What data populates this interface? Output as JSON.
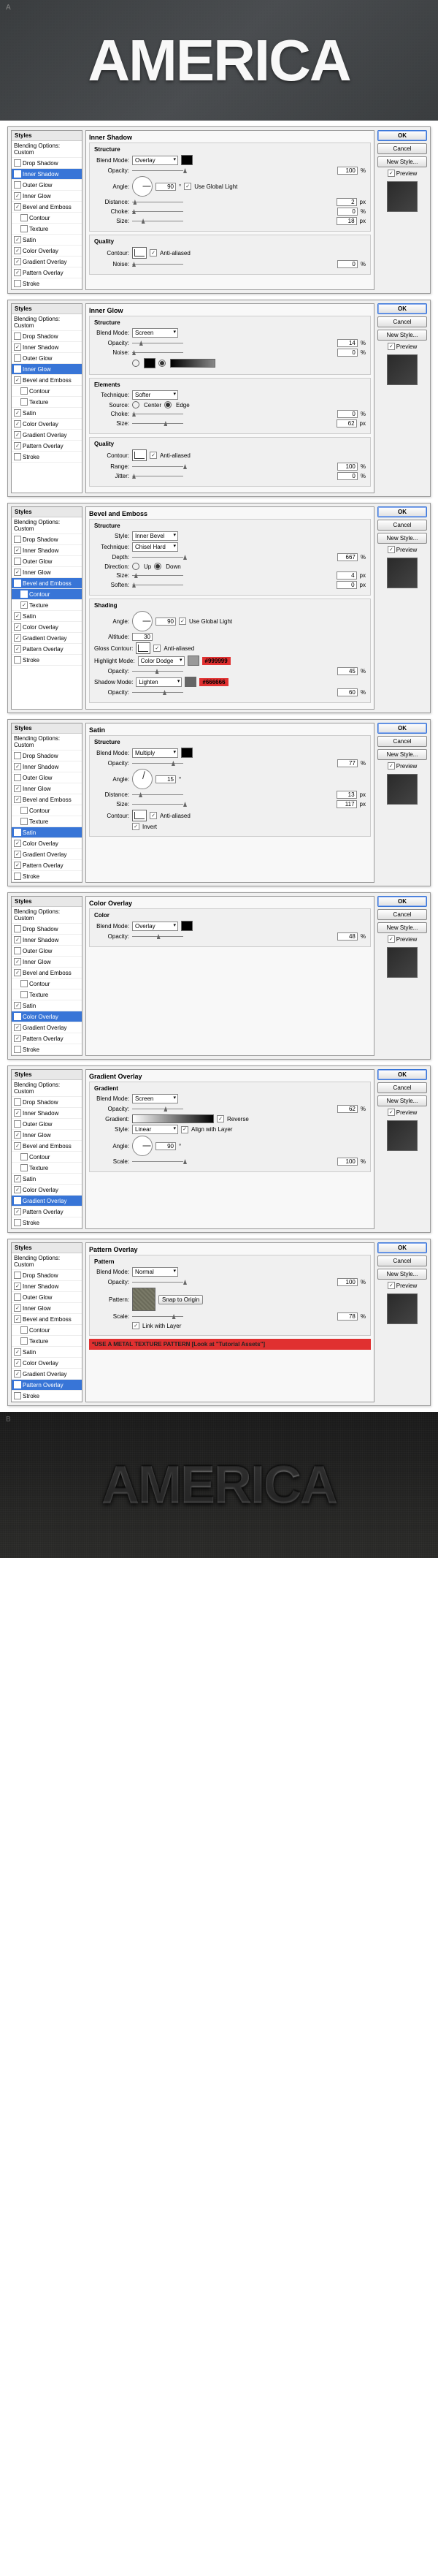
{
  "hero": {
    "label": "A",
    "text": "AMERICA"
  },
  "footer": {
    "label": "B",
    "text": "AMERICA"
  },
  "common": {
    "styles_header": "Styles",
    "blending_options": "Blending Options: Custom",
    "ok": "OK",
    "cancel": "Cancel",
    "new_style": "New Style...",
    "preview": "Preview"
  },
  "style_names": {
    "drop_shadow": "Drop Shadow",
    "inner_shadow": "Inner Shadow",
    "outer_glow": "Outer Glow",
    "inner_glow": "Inner Glow",
    "bevel_emboss": "Bevel and Emboss",
    "contour": "Contour",
    "texture": "Texture",
    "satin": "Satin",
    "color_overlay": "Color Overlay",
    "gradient_overlay": "Gradient Overlay",
    "pattern_overlay": "Pattern Overlay",
    "stroke": "Stroke"
  },
  "panels": [
    {
      "id": "inner_shadow",
      "title": "Inner Shadow",
      "sections": [
        {
          "name": "Structure",
          "fields": [
            {
              "label": "Blend Mode:",
              "type": "dd",
              "value": "Overlay",
              "swatch": "#000"
            },
            {
              "label": "Opacity:",
              "type": "slider",
              "value": 100,
              "unit": "%"
            },
            {
              "label": "Angle:",
              "type": "dial",
              "value": 90,
              "check": "Use Global Light",
              "check_on": true
            },
            {
              "label": "Distance:",
              "type": "slider",
              "value": 2,
              "unit": "px"
            },
            {
              "label": "Choke:",
              "type": "slider",
              "value": 0,
              "unit": "%"
            },
            {
              "label": "Size:",
              "type": "slider",
              "value": 18,
              "unit": "px"
            }
          ]
        },
        {
          "name": "Quality",
          "fields": [
            {
              "label": "Contour:",
              "type": "contour",
              "check": "Anti-aliased",
              "check_on": true
            },
            {
              "label": "Noise:",
              "type": "slider",
              "value": 0,
              "unit": "%"
            }
          ]
        }
      ],
      "checks": {
        "drop_shadow": false,
        "inner_shadow": true,
        "outer_glow": false,
        "inner_glow": true,
        "bevel_emboss": true,
        "contour": false,
        "texture": false,
        "satin": true,
        "color_overlay": true,
        "gradient_overlay": true,
        "pattern_overlay": true,
        "stroke": false
      }
    },
    {
      "id": "inner_glow",
      "title": "Inner Glow",
      "sections": [
        {
          "name": "Structure",
          "fields": [
            {
              "label": "Blend Mode:",
              "type": "dd",
              "value": "Screen"
            },
            {
              "label": "Opacity:",
              "type": "slider",
              "value": 14,
              "unit": "%"
            },
            {
              "label": "Noise:",
              "type": "slider",
              "value": 0,
              "unit": "%"
            },
            {
              "label": "",
              "type": "grad_choice"
            }
          ]
        },
        {
          "name": "Elements",
          "fields": [
            {
              "label": "Technique:",
              "type": "dd",
              "value": "Softer"
            },
            {
              "label": "Source:",
              "type": "radio",
              "options": [
                "Center",
                "Edge"
              ],
              "value": "Edge"
            },
            {
              "label": "Choke:",
              "type": "slider",
              "value": 0,
              "unit": "%"
            },
            {
              "label": "Size:",
              "type": "slider",
              "value": 62,
              "unit": "px"
            }
          ]
        },
        {
          "name": "Quality",
          "fields": [
            {
              "label": "Contour:",
              "type": "contour",
              "check": "Anti-aliased",
              "check_on": true
            },
            {
              "label": "Range:",
              "type": "slider",
              "value": 100,
              "unit": "%"
            },
            {
              "label": "Jitter:",
              "type": "slider",
              "value": 0,
              "unit": "%"
            }
          ]
        }
      ],
      "checks": {
        "drop_shadow": false,
        "inner_shadow": true,
        "outer_glow": false,
        "inner_glow": true,
        "bevel_emboss": true,
        "contour": false,
        "texture": false,
        "satin": true,
        "color_overlay": true,
        "gradient_overlay": true,
        "pattern_overlay": true,
        "stroke": false
      }
    },
    {
      "id": "bevel_emboss",
      "title": "Bevel and Emboss",
      "sections": [
        {
          "name": "Structure",
          "fields": [
            {
              "label": "Style:",
              "type": "dd",
              "value": "Inner Bevel"
            },
            {
              "label": "Technique:",
              "type": "dd",
              "value": "Chisel Hard"
            },
            {
              "label": "Depth:",
              "type": "slider",
              "value": 667,
              "unit": "%"
            },
            {
              "label": "Direction:",
              "type": "radio",
              "options": [
                "Up",
                "Down"
              ],
              "value": "Down"
            },
            {
              "label": "Size:",
              "type": "slider",
              "value": 4,
              "unit": "px"
            },
            {
              "label": "Soften:",
              "type": "slider",
              "value": 0,
              "unit": "px"
            }
          ]
        },
        {
          "name": "Shading",
          "fields": [
            {
              "label": "Angle:",
              "type": "dial2",
              "value": 90,
              "alt_label": "Altitude:",
              "alt_value": 30,
              "check": "Use Global Light",
              "check_on": true
            },
            {
              "label": "Gloss Contour:",
              "type": "contour",
              "check": "Anti-aliased",
              "check_on": true
            },
            {
              "label": "Highlight Mode:",
              "type": "dd",
              "value": "Color Dodge",
              "swatch": "#999",
              "hex": "#999999"
            },
            {
              "label": "Opacity:",
              "type": "slider",
              "value": 45,
              "unit": "%"
            },
            {
              "label": "Shadow Mode:",
              "type": "dd",
              "value": "Lighten",
              "swatch": "#666",
              "hex": "#666666"
            },
            {
              "label": "Opacity:",
              "type": "slider",
              "value": 60,
              "unit": "%"
            }
          ]
        }
      ],
      "checks": {
        "drop_shadow": false,
        "inner_shadow": true,
        "outer_glow": false,
        "inner_glow": true,
        "bevel_emboss": true,
        "contour": true,
        "texture": true,
        "satin": true,
        "color_overlay": true,
        "gradient_overlay": true,
        "pattern_overlay": true,
        "stroke": false
      },
      "sub_sel": "contour"
    },
    {
      "id": "satin",
      "title": "Satin",
      "sections": [
        {
          "name": "Structure",
          "fields": [
            {
              "label": "Blend Mode:",
              "type": "dd",
              "value": "Multiply",
              "swatch": "#000"
            },
            {
              "label": "Opacity:",
              "type": "slider",
              "value": 77,
              "unit": "%"
            },
            {
              "label": "Angle:",
              "type": "dial",
              "value": 15
            },
            {
              "label": "Distance:",
              "type": "slider",
              "value": 13,
              "unit": "px"
            },
            {
              "label": "Size:",
              "type": "slider",
              "value": 117,
              "unit": "px"
            },
            {
              "label": "Contour:",
              "type": "contour",
              "check": "Anti-aliased",
              "check_on": true,
              "check2": "Invert",
              "check2_on": true
            }
          ]
        }
      ],
      "checks": {
        "drop_shadow": false,
        "inner_shadow": true,
        "outer_glow": false,
        "inner_glow": true,
        "bevel_emboss": true,
        "contour": false,
        "texture": false,
        "satin": true,
        "color_overlay": true,
        "gradient_overlay": true,
        "pattern_overlay": true,
        "stroke": false
      }
    },
    {
      "id": "color_overlay",
      "title": "Color Overlay",
      "sections": [
        {
          "name": "Color",
          "fields": [
            {
              "label": "Blend Mode:",
              "type": "dd",
              "value": "Overlay",
              "swatch": "#000"
            },
            {
              "label": "Opacity:",
              "type": "slider",
              "value": 48,
              "unit": "%"
            }
          ]
        }
      ],
      "checks": {
        "drop_shadow": false,
        "inner_shadow": true,
        "outer_glow": false,
        "inner_glow": true,
        "bevel_emboss": true,
        "contour": false,
        "texture": false,
        "satin": true,
        "color_overlay": true,
        "gradient_overlay": true,
        "pattern_overlay": true,
        "stroke": false
      }
    },
    {
      "id": "gradient_overlay",
      "title": "Gradient Overlay",
      "sections": [
        {
          "name": "Gradient",
          "fields": [
            {
              "label": "Blend Mode:",
              "type": "dd",
              "value": "Screen"
            },
            {
              "label": "Opacity:",
              "type": "slider",
              "value": 62,
              "unit": "%"
            },
            {
              "label": "Gradient:",
              "type": "gradbar",
              "check": "Reverse",
              "check_on": true
            },
            {
              "label": "Style:",
              "type": "dd",
              "value": "Linear",
              "check": "Align with Layer",
              "check_on": true
            },
            {
              "label": "Angle:",
              "type": "dial",
              "value": 90
            },
            {
              "label": "Scale:",
              "type": "slider",
              "value": 100,
              "unit": "%"
            }
          ]
        }
      ],
      "checks": {
        "drop_shadow": false,
        "inner_shadow": true,
        "outer_glow": false,
        "inner_glow": true,
        "bevel_emboss": true,
        "contour": false,
        "texture": false,
        "satin": true,
        "color_overlay": true,
        "gradient_overlay": true,
        "pattern_overlay": true,
        "stroke": false
      }
    },
    {
      "id": "pattern_overlay",
      "title": "Pattern Overlay",
      "sections": [
        {
          "name": "Pattern",
          "fields": [
            {
              "label": "Blend Mode:",
              "type": "dd",
              "value": "Normal"
            },
            {
              "label": "Opacity:",
              "type": "slider",
              "value": 100,
              "unit": "%"
            },
            {
              "label": "Pattern:",
              "type": "pattern",
              "btn": "Snap to Origin"
            },
            {
              "label": "Scale:",
              "type": "slider",
              "value": 78,
              "unit": "%"
            },
            {
              "label": "",
              "type": "check_only",
              "check": "Link with Layer",
              "check_on": true
            }
          ]
        }
      ],
      "checks": {
        "drop_shadow": false,
        "inner_shadow": true,
        "outer_glow": false,
        "inner_glow": true,
        "bevel_emboss": true,
        "contour": false,
        "texture": false,
        "satin": true,
        "color_overlay": true,
        "gradient_overlay": true,
        "pattern_overlay": true,
        "stroke": false
      },
      "note": "*USE A METAL TEXTURE PATTERN [Look at \"Tutorial Assets\"]"
    }
  ]
}
